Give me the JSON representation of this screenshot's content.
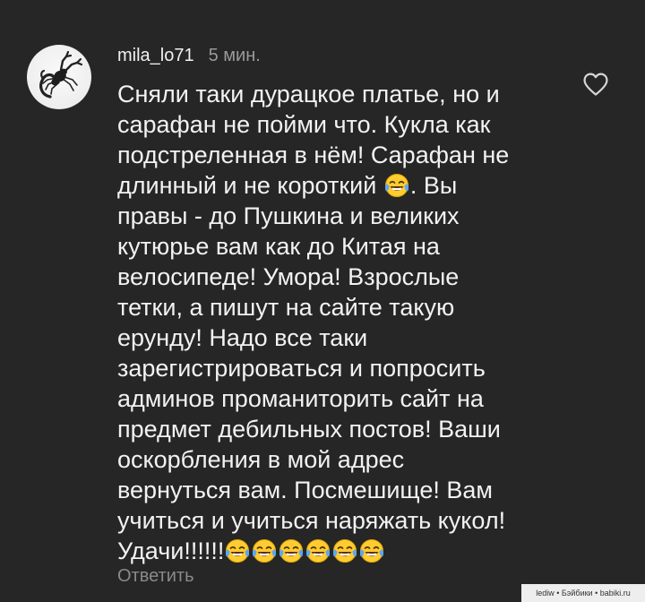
{
  "comment": {
    "avatar_icon": "scorpion-avatar-icon",
    "username": "mila_lo71",
    "timestamp": "5 мин.",
    "text_lines": [
      "Сняли таки дурацкое платье, но и",
      "сарафан не пойми что. Кукла как",
      "подстреленная в нём! Сарафан не",
      "длинный и не короткий",
      ". Вы",
      "правы - до Пушкина и великих",
      "кутюрье вам как до Китая на",
      "велосипеде! Умора! Взрослые",
      "тетки, а пишут на сайте такую",
      "ерунду! Надо все таки",
      "зарегистрироваться и попросить",
      "админов проманиторить сайт на",
      "предмет дебильных постов! Ваши",
      "оскорбления в мой адрес",
      "вернуться вам. Посмешище! Вам",
      "учиться и учиться наряжать кукол!",
      "Удачи!!!!!!"
    ],
    "emoji_icon": "face-with-tears-of-joy-icon",
    "like_icon": "heart-outline-icon",
    "reply_label": "Ответить"
  },
  "colors": {
    "background": "#262626",
    "text": "#f2f2f2",
    "muted": "#9a9a9a",
    "emoji_face": "#ffcc33",
    "emoji_tears": "#5aa7f2"
  },
  "watermark": "lediw • Бэйбики • babiki.ru"
}
